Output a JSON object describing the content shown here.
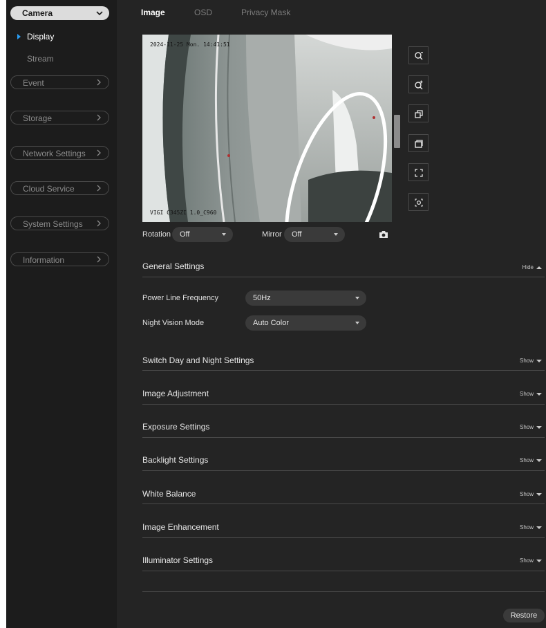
{
  "sidebar": {
    "camera_label": "Camera",
    "sub_items": [
      {
        "label": "Display",
        "active": true
      },
      {
        "label": "Stream",
        "active": false
      }
    ],
    "nav": [
      {
        "label": "Event"
      },
      {
        "label": "Storage"
      },
      {
        "label": "Network Settings"
      },
      {
        "label": "Cloud Service"
      },
      {
        "label": "System Settings"
      },
      {
        "label": "Information"
      }
    ]
  },
  "tabs": [
    {
      "label": "Image",
      "active": true
    },
    {
      "label": "OSD",
      "active": false
    },
    {
      "label": "Privacy Mask",
      "active": false
    }
  ],
  "video": {
    "timestamp": "2024-11-25 Mon. 14:41:51",
    "camera_name": "VIGI C345ZI 1.0_C960"
  },
  "tools": [
    "zoom-out-icon",
    "zoom-in-icon",
    "restore-window-icon",
    "window-icon",
    "fullscreen-icon",
    "focus-target-icon"
  ],
  "controls": {
    "rotation_label": "Rotation",
    "rotation_value": "Off",
    "mirror_label": "Mirror",
    "mirror_value": "Off"
  },
  "general": {
    "title": "General Settings",
    "toggle": "Hide",
    "power_line_label": "Power Line Frequency",
    "power_line_value": "50Hz",
    "night_vision_label": "Night Vision Mode",
    "night_vision_value": "Auto Color"
  },
  "sections": [
    {
      "title": "Switch Day and Night Settings",
      "toggle": "Show"
    },
    {
      "title": "Image Adjustment",
      "toggle": "Show"
    },
    {
      "title": "Exposure Settings",
      "toggle": "Show"
    },
    {
      "title": "Backlight Settings",
      "toggle": "Show"
    },
    {
      "title": "White Balance",
      "toggle": "Show"
    },
    {
      "title": "Image Enhancement",
      "toggle": "Show"
    },
    {
      "title": "Illuminator Settings",
      "toggle": "Show"
    }
  ],
  "restore_label": "Restore",
  "colors": {
    "accent": "#2a9df4",
    "panel": "#242424",
    "sidebar": "#1c1c1c"
  }
}
